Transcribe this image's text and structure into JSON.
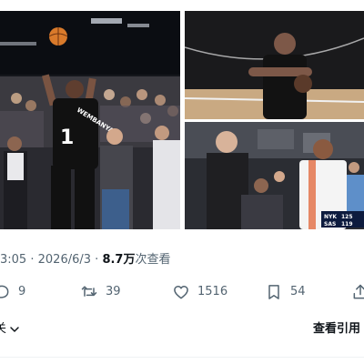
{
  "tweet": {
    "media": [
      {
        "jersey_name": "WEMBANYAMA",
        "jersey_number": "1"
      },
      {},
      {
        "scoreboard": {
          "team1": "NYK",
          "score1": "125",
          "team2": "SAS",
          "score2": "119"
        }
      }
    ],
    "meta": {
      "time": "3:05",
      "separator": "·",
      "date": "2026/6/3",
      "views_count": "8.7万",
      "views_label": "次查看"
    },
    "actions": {
      "reply_count": "9",
      "retweet_count": "39",
      "like_count": "1516",
      "bookmark_count": "54"
    },
    "related_label": "关",
    "quotes_label": "查看引用"
  },
  "colors": {
    "text_primary": "#0f1419",
    "text_secondary": "#536471",
    "divider": "#eff3f4",
    "spurs_black": "#111111",
    "knicks_white": "#f4f4f4"
  },
  "icons": {
    "reply": "reply-icon",
    "retweet": "retweet-icon",
    "like": "heart-icon",
    "bookmark": "bookmark-icon",
    "share": "share-icon",
    "related_expand": "chevron-down-icon"
  }
}
